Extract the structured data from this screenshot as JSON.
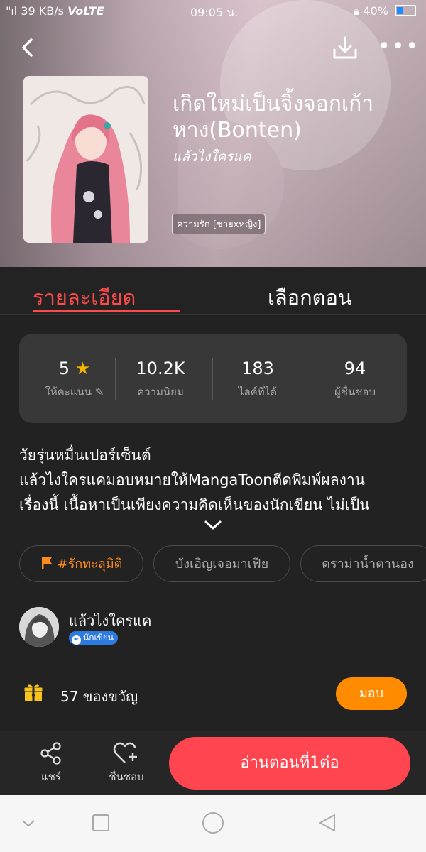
{
  "status_bar": {
    "signal": "\"ıl",
    "speed": "39 KB/s",
    "network": "VoLTE",
    "time": "09:05 น.",
    "battery": "40%"
  },
  "colors": {
    "accent_red": "#ff4a4a",
    "read_button": "#ff454f",
    "give_button": "#ff8c00",
    "star": "#f7b500",
    "tag_orange": "#ff8a1c",
    "writer_badge": "#2d7be0"
  },
  "header": {
    "back_icon": "chevron-left-icon",
    "download_icon": "download-icon",
    "more_label": "•••"
  },
  "book": {
    "title": "เกิดใหม่เป็นจิ้งจอกเก้าหาง(Bonten)",
    "author": "แล้วไงใครแค",
    "genre_tag": "ความรัก [ชายxหญิง]"
  },
  "tabs": {
    "details": "รายละเอียด",
    "episodes": "เลือกตอน"
  },
  "stats": [
    {
      "value": "5",
      "label": "ให้คะแนน"
    },
    {
      "value": "10.2K",
      "label": "ความนิยม"
    },
    {
      "value": "183",
      "label": "ไลค์ที่ได้"
    },
    {
      "value": "94",
      "label": "ผู้ชื่นชอบ"
    }
  ],
  "description": {
    "line1": "วัยรุ่นหมื่นเปอร์เซ็นต์",
    "line2": "แล้วไงใครแคมอบหมายให้MangaToonตีดพิมพ์ผลงาน",
    "line3": "เรื่องนี้ เนื้อหาเป็นเพียงความคิดเห็นของนักเขียน ไม่เป็น"
  },
  "chips": {
    "romance": "#รักทะลุมิติ",
    "mafia": "บังเอิญเจอมาเฟีย",
    "drama": "ดราม่าน้ำตานอง"
  },
  "author": {
    "name": "แล้วไงใครแค",
    "badge": "นักเขียน"
  },
  "gifts": {
    "count": "57 ของขวัญ",
    "give_label": "มอบ"
  },
  "bottom_bar": {
    "share": "แชร์",
    "favorite": "ชื่นชอบ",
    "read": "อ่านตอนที่1ต่อ"
  }
}
